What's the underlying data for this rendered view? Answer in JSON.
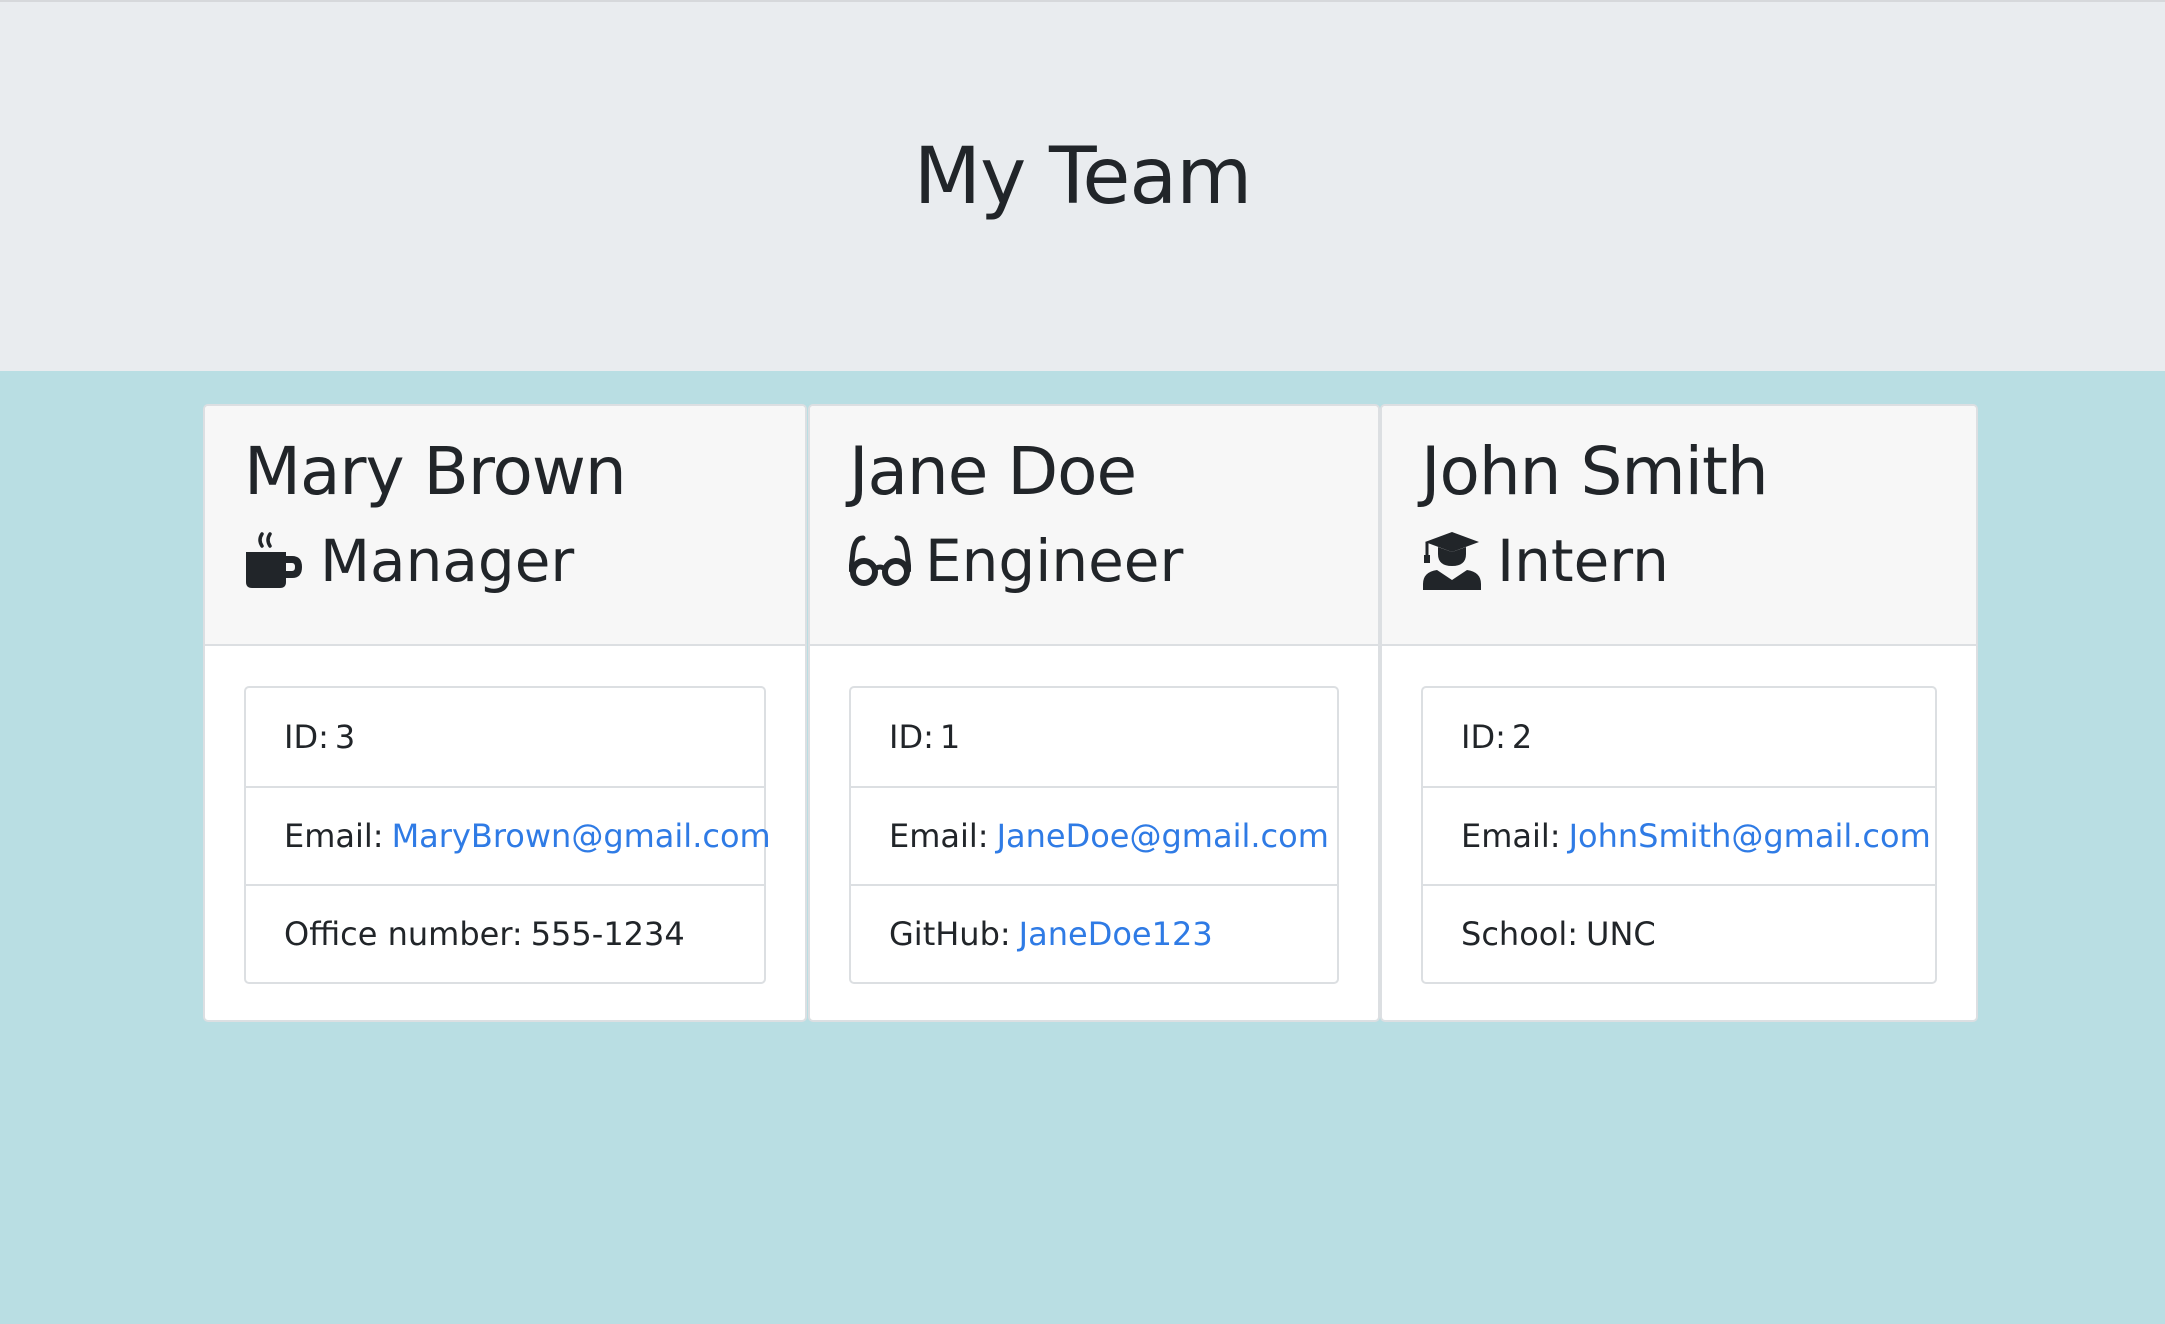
{
  "header": {
    "title": "My Team"
  },
  "employees": [
    {
      "name": "Mary Brown",
      "role": "Manager",
      "icon": "coffee-mug-icon",
      "id_label": "ID:",
      "id": "3",
      "email_label": "Email:",
      "email": "MaryBrown@gmail.com",
      "extra_label": "Office number:",
      "extra_value": "555-1234"
    },
    {
      "name": "Jane Doe",
      "role": "Engineer",
      "icon": "glasses-icon",
      "id_label": "ID:",
      "id": "1",
      "email_label": "Email:",
      "email": "JaneDoe@gmail.com",
      "extra_label": "GitHub:",
      "extra_value": "JaneDoe123"
    },
    {
      "name": "John Smith",
      "role": "Intern",
      "icon": "graduate-icon",
      "id_label": "ID:",
      "id": "2",
      "email_label": "Email:",
      "email": "JohnSmith@gmail.com",
      "extra_label": "School:",
      "extra_value": "UNC"
    }
  ],
  "colors": {
    "background": "#b9dee3",
    "header_background": "#e9ecef",
    "link": "#2f7be5"
  }
}
